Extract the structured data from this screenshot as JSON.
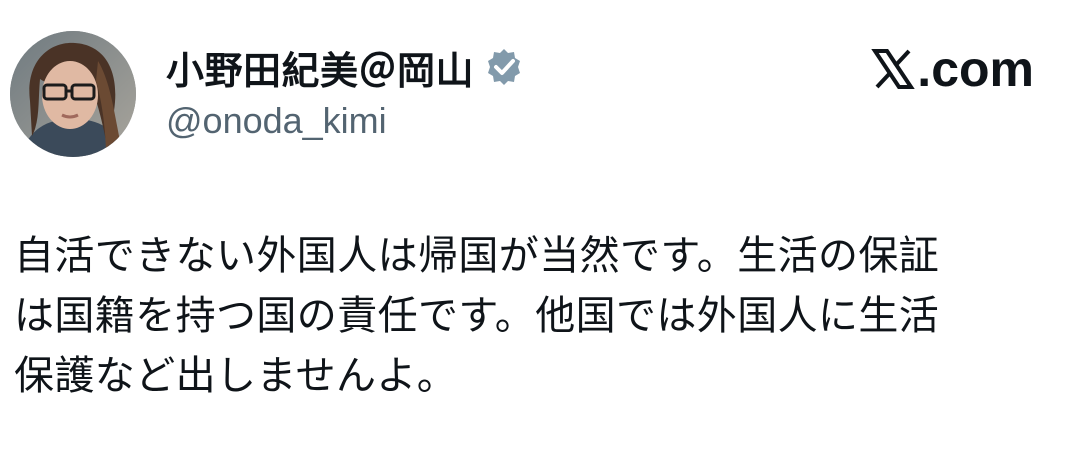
{
  "post": {
    "author": {
      "display_name": "小野田紀美＠岡山",
      "handle": "@onoda_kimi",
      "verified": true,
      "verified_badge_color": "#829aab"
    },
    "source": {
      "label": ".com",
      "logo_icon": "x-logo-icon"
    },
    "text_lines": [
      "自活できない外国人は帰国が当然です。生活の保証",
      "は国籍を持つ国の責任です。他国では外国人に生活",
      "保護など出しませんよ。"
    ]
  },
  "colors": {
    "background": "#ffffff",
    "text": "#0f1419",
    "secondary_text": "#536471"
  }
}
